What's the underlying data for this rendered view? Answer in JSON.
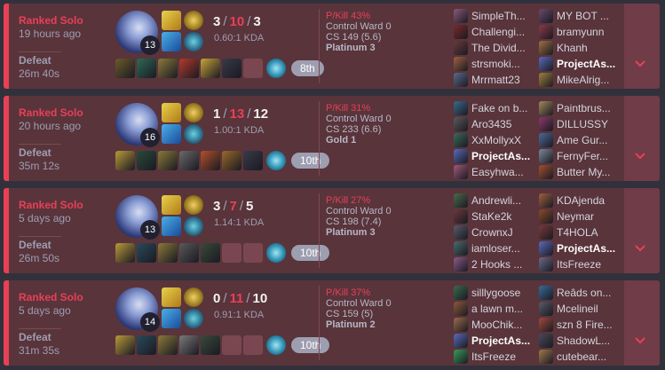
{
  "matches": [
    {
      "queue": "Ranked Solo",
      "ago": "19 hours ago",
      "result": "Defeat",
      "length": "26m 40s",
      "level": "13",
      "kills": "3",
      "deaths": "10",
      "assists": "3",
      "kda_ratio": "0.60:1 KDA",
      "p_kill": "P/Kill 43%",
      "control_ward": "Control Ward 0",
      "cs": "CS 149 (5.6)",
      "tier": "Platinum 3",
      "placement": "8th",
      "items": [
        "#6b5b2b",
        "#2d6a55",
        "#8a7a3a",
        "#b43a2a",
        "#c8a23a",
        "#3a3a4a",
        "empty"
      ],
      "team1": [
        {
          "name": "SimpleTh...",
          "color": "#8a5a7a"
        },
        {
          "name": "Challengi...",
          "color": "#7a2a2a"
        },
        {
          "name": "The Divid...",
          "color": "#6a3a3a"
        },
        {
          "name": "strsmoki...",
          "color": "#a06040"
        },
        {
          "name": "Mrrmatt23",
          "color": "#5a6a8a"
        }
      ],
      "team2": [
        {
          "name": "MY BOT ...",
          "color": "#6a4a6a"
        },
        {
          "name": "bramyunn",
          "color": "#8a3a4a"
        },
        {
          "name": "Khanh",
          "color": "#a07040"
        },
        {
          "name": "ProjectAs...",
          "color": "#5a6ab8",
          "me": true
        },
        {
          "name": "MikeAlrig...",
          "color": "#a08040"
        }
      ]
    },
    {
      "queue": "Ranked Solo",
      "ago": "20 hours ago",
      "result": "Defeat",
      "length": "35m 12s",
      "level": "16",
      "kills": "1",
      "deaths": "13",
      "assists": "12",
      "kda_ratio": "1.00:1 KDA",
      "p_kill": "P/Kill 31%",
      "control_ward": "Control Ward 0",
      "cs": "CS 233 (6.6)",
      "tier": "Gold 1",
      "placement": "10th",
      "items": [
        "#b89a3a",
        "#2a4a3a",
        "#8a7a3a",
        "#6a6a6a",
        "#b4502a",
        "#9a6a2a",
        "#3a3a4a"
      ],
      "team1": [
        {
          "name": "Fake on b...",
          "color": "#3a6a8a"
        },
        {
          "name": "Aro3435",
          "color": "#5a5a5a"
        },
        {
          "name": "XxMollyxX",
          "color": "#3a6a5a"
        },
        {
          "name": "ProjectAs...",
          "color": "#5a6ab8",
          "me": true
        },
        {
          "name": "Easyhwa...",
          "color": "#a05a7a"
        }
      ],
      "team2": [
        {
          "name": "Paintbrus...",
          "color": "#a08a5a"
        },
        {
          "name": "DILLUSSY",
          "color": "#8a3a6a"
        },
        {
          "name": "Ame Gur...",
          "color": "#4a6a9a"
        },
        {
          "name": "FernyFer...",
          "color": "#7a8a9a"
        },
        {
          "name": "Butter My...",
          "color": "#a05030"
        }
      ]
    },
    {
      "queue": "Ranked Solo",
      "ago": "5 days ago",
      "result": "Defeat",
      "length": "26m 50s",
      "level": "13",
      "kills": "3",
      "deaths": "7",
      "assists": "5",
      "kda_ratio": "1.14:1 KDA",
      "p_kill": "P/Kill 27%",
      "control_ward": "Control Ward 0",
      "cs": "CS 198 (7.4)",
      "tier": "Platinum 3",
      "placement": "10th",
      "items": [
        "#b89a3a",
        "#2a4a5a",
        "#8a7a3a",
        "#5a5a5a",
        "#3a4a3a",
        "empty",
        "empty"
      ],
      "team1": [
        {
          "name": "Andrewli...",
          "color": "#4a6a4a"
        },
        {
          "name": "StaKe2k",
          "color": "#6a3a3a"
        },
        {
          "name": "CrownxJ",
          "color": "#5a5a6a"
        },
        {
          "name": "iamloser...",
          "color": "#4a6a6a"
        },
        {
          "name": "2 Hooks ...",
          "color": "#8a5a8a"
        }
      ],
      "team2": [
        {
          "name": "KDAjenda",
          "color": "#a06040"
        },
        {
          "name": "Neymar",
          "color": "#8a4a2a"
        },
        {
          "name": "T4HOLA",
          "color": "#7a3a3a"
        },
        {
          "name": "ProjectAs...",
          "color": "#5a6ab8",
          "me": true
        },
        {
          "name": "ItsFreeze",
          "color": "#6a6a8a"
        }
      ]
    },
    {
      "queue": "Ranked Solo",
      "ago": "5 days ago",
      "result": "Defeat",
      "length": "31m 35s",
      "level": "14",
      "kills": "0",
      "deaths": "11",
      "assists": "10",
      "kda_ratio": "0.91:1 KDA",
      "p_kill": "P/Kill 37%",
      "control_ward": "Control Ward 0",
      "cs": "CS 159 (5)",
      "tier": "Platinum 2",
      "placement": "10th",
      "items": [
        "#b89a3a",
        "#2a4a5a",
        "#8a7a3a",
        "#7a7a7a",
        "#3a4a3a",
        "empty",
        "empty"
      ],
      "team1": [
        {
          "name": "silllygoose",
          "color": "#3a6a4a"
        },
        {
          "name": "a lawn m...",
          "color": "#8a5a3a"
        },
        {
          "name": "MooChik...",
          "color": "#9a6a4a"
        },
        {
          "name": "ProjectAs...",
          "color": "#5a6ab8",
          "me": true
        },
        {
          "name": "ItsFreeze",
          "color": "#3a9a5a"
        }
      ],
      "team2": [
        {
          "name": "Reâds on...",
          "color": "#3a6a9a"
        },
        {
          "name": "Mcelineil",
          "color": "#5a5a6a"
        },
        {
          "name": "szn 8 Fire...",
          "color": "#a04a3a"
        },
        {
          "name": "ShadowL...",
          "color": "#4a4a5a"
        },
        {
          "name": "cutebear...",
          "color": "#a07a4a"
        }
      ]
    }
  ],
  "icons": {
    "champion": "champion-portrait-icon",
    "summoner_spell_1": "flash-spell-icon",
    "summoner_spell_2": "teleport-spell-icon",
    "keystone_rune": "keystone-rune-icon",
    "secondary_rune": "secondary-rune-icon",
    "trinket": "ward-trinket-icon",
    "expand": "chevron-down-icon"
  },
  "colors": {
    "defeat_accent": "#e84057",
    "row_bg": "#59343b",
    "expand_bg": "#703c47",
    "placement_badge": "#9e9eb1"
  }
}
